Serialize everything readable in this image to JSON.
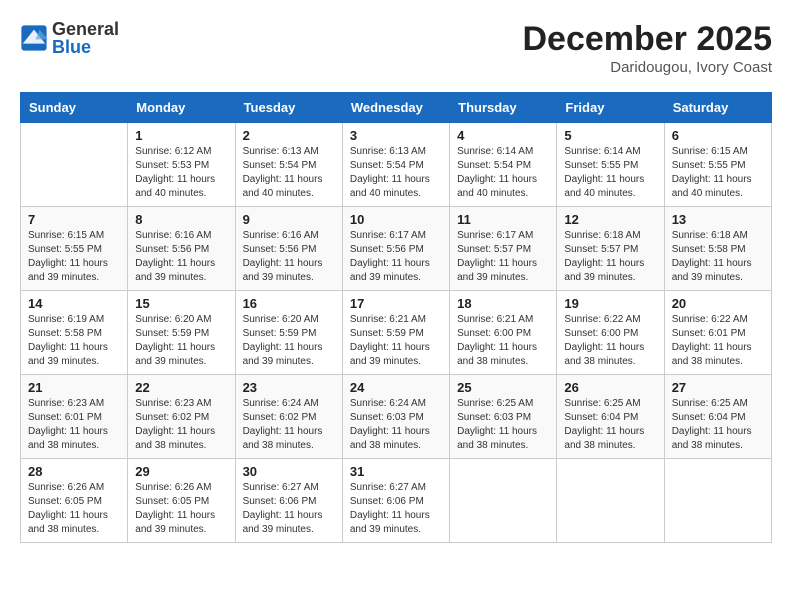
{
  "header": {
    "logo_general": "General",
    "logo_blue": "Blue",
    "month_title": "December 2025",
    "subtitle": "Daridougou, Ivory Coast"
  },
  "days_of_week": [
    "Sunday",
    "Monday",
    "Tuesday",
    "Wednesday",
    "Thursday",
    "Friday",
    "Saturday"
  ],
  "weeks": [
    [
      {
        "day": "",
        "sunrise": "",
        "sunset": "",
        "daylight": ""
      },
      {
        "day": "1",
        "sunrise": "6:12 AM",
        "sunset": "5:53 PM",
        "daylight": "11 hours and 40 minutes."
      },
      {
        "day": "2",
        "sunrise": "6:13 AM",
        "sunset": "5:54 PM",
        "daylight": "11 hours and 40 minutes."
      },
      {
        "day": "3",
        "sunrise": "6:13 AM",
        "sunset": "5:54 PM",
        "daylight": "11 hours and 40 minutes."
      },
      {
        "day": "4",
        "sunrise": "6:14 AM",
        "sunset": "5:54 PM",
        "daylight": "11 hours and 40 minutes."
      },
      {
        "day": "5",
        "sunrise": "6:14 AM",
        "sunset": "5:55 PM",
        "daylight": "11 hours and 40 minutes."
      },
      {
        "day": "6",
        "sunrise": "6:15 AM",
        "sunset": "5:55 PM",
        "daylight": "11 hours and 40 minutes."
      }
    ],
    [
      {
        "day": "7",
        "sunrise": "6:15 AM",
        "sunset": "5:55 PM",
        "daylight": "11 hours and 39 minutes."
      },
      {
        "day": "8",
        "sunrise": "6:16 AM",
        "sunset": "5:56 PM",
        "daylight": "11 hours and 39 minutes."
      },
      {
        "day": "9",
        "sunrise": "6:16 AM",
        "sunset": "5:56 PM",
        "daylight": "11 hours and 39 minutes."
      },
      {
        "day": "10",
        "sunrise": "6:17 AM",
        "sunset": "5:56 PM",
        "daylight": "11 hours and 39 minutes."
      },
      {
        "day": "11",
        "sunrise": "6:17 AM",
        "sunset": "5:57 PM",
        "daylight": "11 hours and 39 minutes."
      },
      {
        "day": "12",
        "sunrise": "6:18 AM",
        "sunset": "5:57 PM",
        "daylight": "11 hours and 39 minutes."
      },
      {
        "day": "13",
        "sunrise": "6:18 AM",
        "sunset": "5:58 PM",
        "daylight": "11 hours and 39 minutes."
      }
    ],
    [
      {
        "day": "14",
        "sunrise": "6:19 AM",
        "sunset": "5:58 PM",
        "daylight": "11 hours and 39 minutes."
      },
      {
        "day": "15",
        "sunrise": "6:20 AM",
        "sunset": "5:59 PM",
        "daylight": "11 hours and 39 minutes."
      },
      {
        "day": "16",
        "sunrise": "6:20 AM",
        "sunset": "5:59 PM",
        "daylight": "11 hours and 39 minutes."
      },
      {
        "day": "17",
        "sunrise": "6:21 AM",
        "sunset": "5:59 PM",
        "daylight": "11 hours and 39 minutes."
      },
      {
        "day": "18",
        "sunrise": "6:21 AM",
        "sunset": "6:00 PM",
        "daylight": "11 hours and 38 minutes."
      },
      {
        "day": "19",
        "sunrise": "6:22 AM",
        "sunset": "6:00 PM",
        "daylight": "11 hours and 38 minutes."
      },
      {
        "day": "20",
        "sunrise": "6:22 AM",
        "sunset": "6:01 PM",
        "daylight": "11 hours and 38 minutes."
      }
    ],
    [
      {
        "day": "21",
        "sunrise": "6:23 AM",
        "sunset": "6:01 PM",
        "daylight": "11 hours and 38 minutes."
      },
      {
        "day": "22",
        "sunrise": "6:23 AM",
        "sunset": "6:02 PM",
        "daylight": "11 hours and 38 minutes."
      },
      {
        "day": "23",
        "sunrise": "6:24 AM",
        "sunset": "6:02 PM",
        "daylight": "11 hours and 38 minutes."
      },
      {
        "day": "24",
        "sunrise": "6:24 AM",
        "sunset": "6:03 PM",
        "daylight": "11 hours and 38 minutes."
      },
      {
        "day": "25",
        "sunrise": "6:25 AM",
        "sunset": "6:03 PM",
        "daylight": "11 hours and 38 minutes."
      },
      {
        "day": "26",
        "sunrise": "6:25 AM",
        "sunset": "6:04 PM",
        "daylight": "11 hours and 38 minutes."
      },
      {
        "day": "27",
        "sunrise": "6:25 AM",
        "sunset": "6:04 PM",
        "daylight": "11 hours and 38 minutes."
      }
    ],
    [
      {
        "day": "28",
        "sunrise": "6:26 AM",
        "sunset": "6:05 PM",
        "daylight": "11 hours and 38 minutes."
      },
      {
        "day": "29",
        "sunrise": "6:26 AM",
        "sunset": "6:05 PM",
        "daylight": "11 hours and 39 minutes."
      },
      {
        "day": "30",
        "sunrise": "6:27 AM",
        "sunset": "6:06 PM",
        "daylight": "11 hours and 39 minutes."
      },
      {
        "day": "31",
        "sunrise": "6:27 AM",
        "sunset": "6:06 PM",
        "daylight": "11 hours and 39 minutes."
      },
      {
        "day": "",
        "sunrise": "",
        "sunset": "",
        "daylight": ""
      },
      {
        "day": "",
        "sunrise": "",
        "sunset": "",
        "daylight": ""
      },
      {
        "day": "",
        "sunrise": "",
        "sunset": "",
        "daylight": ""
      }
    ]
  ],
  "labels": {
    "sunrise": "Sunrise:",
    "sunset": "Sunset:",
    "daylight": "Daylight:"
  }
}
